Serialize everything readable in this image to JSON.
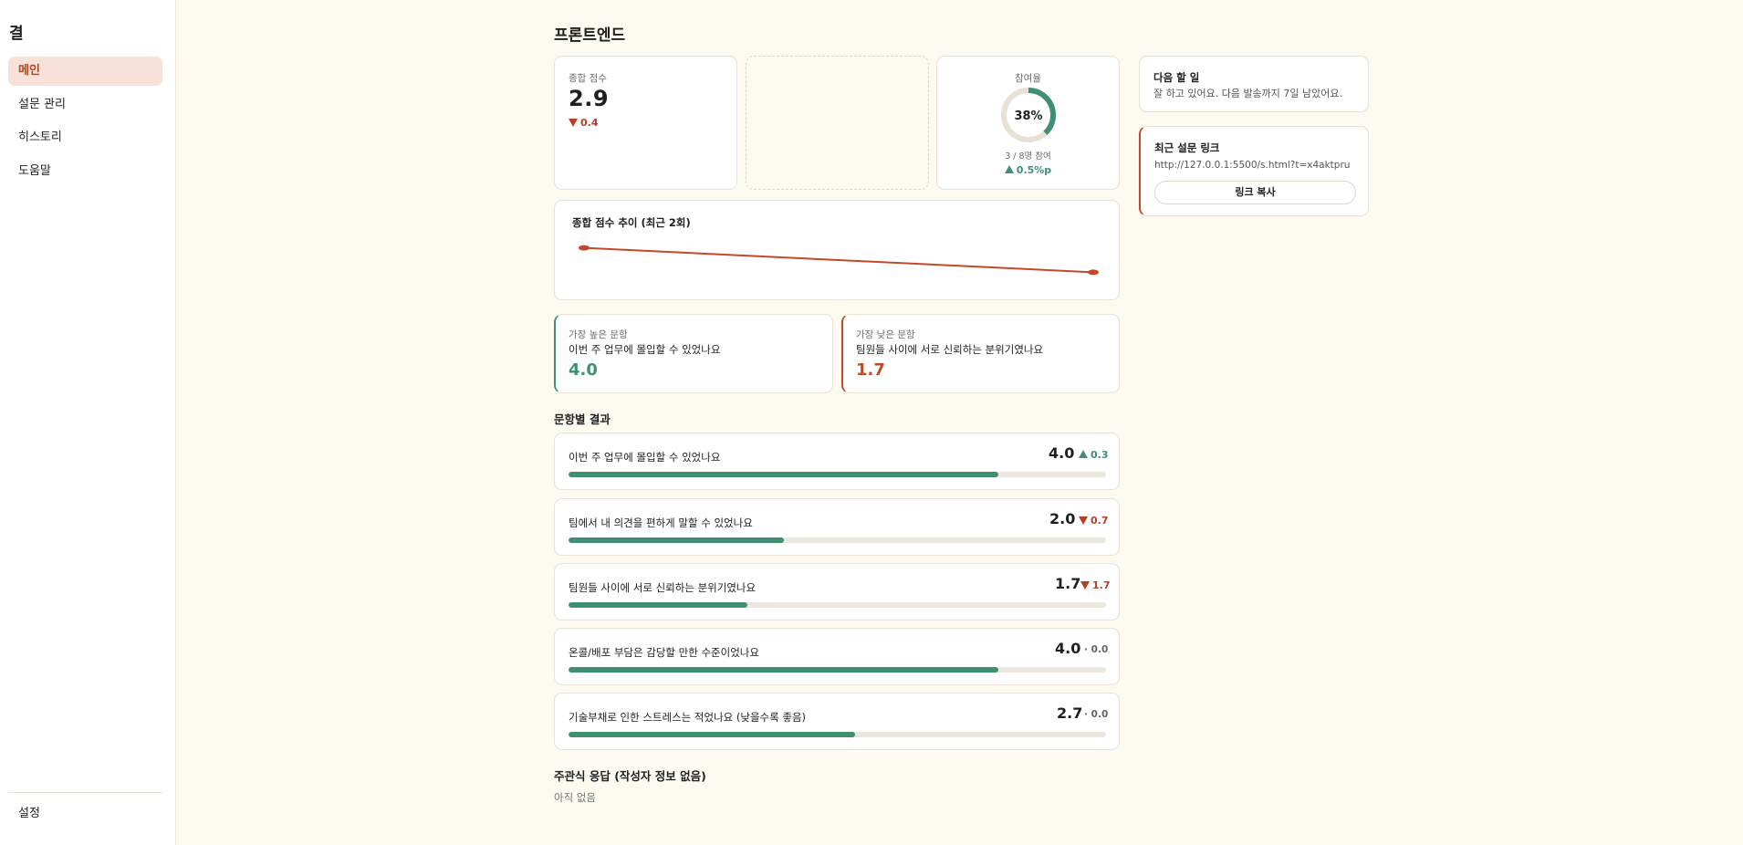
{
  "sidebar": {
    "brand": "결",
    "items": [
      {
        "label": "메인",
        "active": true
      },
      {
        "label": "설문 관리"
      },
      {
        "label": "히스토리"
      },
      {
        "label": "도움말"
      }
    ],
    "settings": "설정"
  },
  "page": {
    "title": "프론트엔드"
  },
  "score_card": {
    "label": "종합 점수",
    "value": "2.9",
    "delta": "0.4",
    "delta_dir": "down"
  },
  "participation": {
    "label": "참여율",
    "percent_text": "38%",
    "percent": 38,
    "detail": "3 / 8명 참여",
    "delta": "0.5%p",
    "delta_dir": "up"
  },
  "trend_card": {
    "title": "종합 점수 추이 (최근 2회)"
  },
  "chart_data": {
    "type": "line",
    "x": [
      1,
      2
    ],
    "series": [
      {
        "values": [
          3.3,
          2.9
        ]
      }
    ],
    "ylim": [
      2.8,
      3.4
    ],
    "color": "#c2492a",
    "title": "종합 점수 추이 (최근 2회)"
  },
  "highest": {
    "label": "가장 높은 문항",
    "question": "이번 주 업무에 몰입할 수 있었나요",
    "score": "4.0"
  },
  "lowest": {
    "label": "가장 낮은 문항",
    "question": "팀원들 사이에 서로 신뢰하는 분위기였나요",
    "score": "1.7"
  },
  "results": {
    "title": "문항별 결과",
    "items": [
      {
        "question": "이번 주 업무에 몰입할 수 있었나요",
        "score": "4.0",
        "delta": "0.3",
        "delta_dir": "up",
        "fraction": 0.8
      },
      {
        "question": "팀에서 내 의견을 편하게 말할 수 있었나요",
        "score": "2.0",
        "delta": "0.7",
        "delta_dir": "down",
        "fraction": 0.4
      },
      {
        "question": "팀원들 사이에 서로 신뢰하는 분위기였나요",
        "score": "1.7",
        "delta": "1.7",
        "delta_dir": "down",
        "fraction": 0.333
      },
      {
        "question": "온콜/배포 부담은 감당할 만한 수준이었나요",
        "score": "4.0",
        "delta": "· 0.0",
        "delta_dir": "flat",
        "fraction": 0.8
      },
      {
        "question": "기술부채로 인한 스트레스는 적었나요 (낮을수록 좋음)",
        "score": "2.7",
        "delta": "· 0.0",
        "delta_dir": "flat",
        "fraction": 0.533
      }
    ]
  },
  "open_answers": {
    "title": "주관식 응답 (작성자 정보 없음)",
    "empty": "아직 없음"
  },
  "todo": {
    "title": "다음 할 일",
    "text": "잘 하고 있어요. 다음 발송까지 7일 남았어요."
  },
  "link_card": {
    "title": "최근 설문 링크",
    "url": "http://127.0.0.1:5500/s.html?t=x4aktpru",
    "button": "링크 복사"
  },
  "colors": {
    "accent": "#c2492a",
    "green": "#3f9070",
    "red": "#b73e24",
    "bg": "#fcfaf1"
  }
}
